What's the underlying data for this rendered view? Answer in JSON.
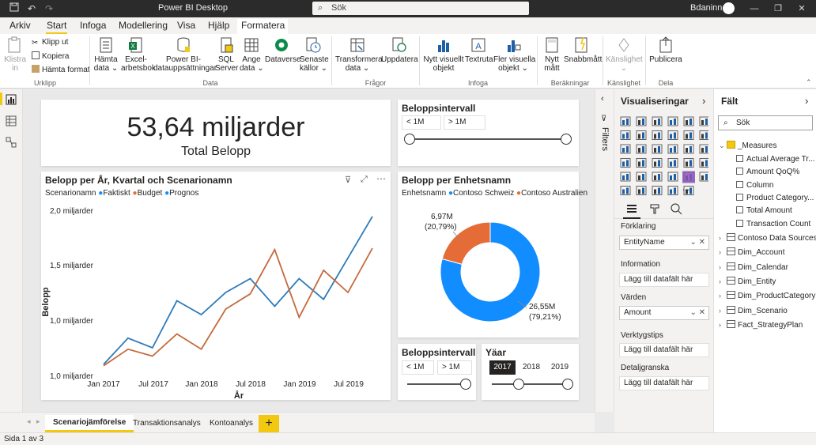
{
  "titlebar": {
    "title": "Power BI Desktop",
    "search_placeholder": "Sök",
    "user_name": "Bdaninn"
  },
  "menu": {
    "tabs": [
      "Arkiv",
      "Start",
      "Infoga",
      "Modellering",
      "Visa",
      "Hjälp",
      "Formatera"
    ],
    "active": "Start"
  },
  "ribbon": {
    "clipboard": {
      "paste_label": "Klistra\nin",
      "cut_label": "Klipp ut",
      "copy_label": "Kopiera",
      "format_label": "Hämta format",
      "group": "Urklipp"
    },
    "data": {
      "items": [
        "Hämta\ndata ⌄",
        "Excel-\narbetsbok",
        "Power BI-\ndatauppsättningar",
        "SQL\nServer",
        "Ange\ndata ⌄",
        "Dataverse",
        "Senaste\nkällor ⌄"
      ],
      "group": "Data"
    },
    "queries": {
      "items": [
        "Transformera\ndata ⌄",
        "Uppdatera"
      ],
      "group": "Frågor"
    },
    "insert": {
      "items": [
        "Nytt visuellt\nobjekt",
        "Textruta",
        "Fler visuella\nobjekt ⌄"
      ],
      "group": "Infoga"
    },
    "calc": {
      "items": [
        "Nytt\nmått",
        "Snabbmått"
      ],
      "group": "Beräkningar"
    },
    "sensitivity": {
      "items": [
        "Känslighet\n⌄"
      ],
      "group": "Känslighet"
    },
    "share": {
      "items": [
        "Publicera"
      ],
      "group": "Dela"
    }
  },
  "canvas": {
    "kpi": {
      "value": "53,64 miljarder",
      "label": "Total Belopp"
    },
    "slicer_top": {
      "title": "Beloppsintervall",
      "min": "< 1M",
      "max": "> 1M"
    },
    "line_chart": {
      "title": "Belopp per År, Kvartal och Scenarionamn",
      "legend_title": "Scenarionamn",
      "legend": [
        "Faktiskt",
        "Budget",
        "Prognos"
      ],
      "y_title": "Belopp",
      "x_title": "År",
      "y_ticks": [
        "2,0 miljarder",
        "1,5 miljarder",
        "1,0 miljarder",
        "1,0 miljarder"
      ],
      "x_ticks": [
        "Jan 2017",
        "Jul 2017",
        "Jan 2018",
        "Jul 2018",
        "Jan 2019",
        "Jul 2019"
      ]
    },
    "donut": {
      "title": "Belopp per Enhetsnamn",
      "legend_title": "Enhetsnamn",
      "legend": [
        "Contoso Schweiz",
        "Contoso Australien"
      ],
      "label_big_value": "26,55M",
      "label_big_pct": "(79,21%)",
      "label_small_value": "6,97M",
      "label_small_pct": "(20,79%)"
    },
    "slicer_bottom": {
      "title": "Beloppsintervall",
      "min": "< 1M",
      "max": "> 1M"
    },
    "year_slicer": {
      "title": "Yäar",
      "years": [
        "2017",
        "2018",
        "2019"
      ],
      "selected": "2017"
    }
  },
  "chart_data": [
    {
      "type": "line",
      "title": "Belopp per År, Kvartal och Scenarionamn",
      "xlabel": "År",
      "ylabel": "Belopp",
      "x": [
        "Jan 2017",
        "Apr 2017",
        "Jul 2017",
        "Okt 2017",
        "Jan 2018",
        "Apr 2018",
        "Jul 2018",
        "Okt 2018",
        "Jan 2019",
        "Apr 2019",
        "Jul 2019",
        "Okt 2019"
      ],
      "series": [
        {
          "name": "Faktiskt",
          "color": "#118dff",
          "values": [
            0.88,
            1.07,
            1.0,
            1.34,
            1.24,
            1.4,
            1.5,
            1.3,
            1.5,
            1.35,
            1.65,
            1.95
          ]
        },
        {
          "name": "Budget",
          "color": "#e66c37",
          "values": [
            0.87,
            0.99,
            0.94,
            1.1,
            0.99,
            1.28,
            1.39,
            1.71,
            1.22,
            1.56,
            1.4,
            1.72
          ]
        },
        {
          "name": "Prognos",
          "color": "#12239e",
          "values": []
        }
      ],
      "ylim": [
        0.8,
        2.0
      ],
      "grid": false,
      "legend": "top-left"
    },
    {
      "type": "pie",
      "title": "Belopp per Enhetsnamn",
      "categories": [
        "Contoso Schweiz",
        "Contoso Australien"
      ],
      "values": [
        26.55,
        6.97
      ],
      "colors": [
        "#118dff",
        "#e66c37"
      ],
      "donut": true,
      "legend": "top"
    }
  ],
  "viz_pane": {
    "title": "Visualiseringar",
    "wells": {
      "legend_label": "Förklaring",
      "legend_value": "EntityName",
      "info_label": "Information",
      "info_placeholder": "Lägg till datafält här",
      "values_label": "Värden",
      "values_value": "Amount",
      "tooltips_label": "Verktygstips",
      "tooltips_placeholder": "Lägg till datafält här",
      "drill_label": "Detaljgranska",
      "drill_placeholder": "Lägg till datafält här"
    },
    "more": "..."
  },
  "filters_label": "Filters",
  "fields_pane": {
    "title": "Fält",
    "search_placeholder": "Sök",
    "measures_table": "_Measures",
    "measures": [
      "Actual Average Tr...",
      "Amount QoQ%",
      "Column",
      "Product Category...",
      "Total Amount",
      "Transaction Count"
    ],
    "tables": [
      "Contoso Data Sources",
      "Dim_Account",
      "Dim_Calendar",
      "Dim_Entity",
      "Dim_ProductCategory",
      "Dim_Scenario",
      "Fact_StrategyPlan"
    ]
  },
  "pages": {
    "tabs": [
      "Scenariojämförelse",
      "Transaktionsanalys",
      "Kontoanalys"
    ],
    "active": "Scenariojämförelse",
    "add": "+"
  },
  "status": {
    "page_info": "Sida 1 av 3"
  },
  "colors": {
    "accent": "#f2c811",
    "series_blue": "#118dff",
    "series_orange": "#e66c37",
    "series_navy": "#12239e"
  }
}
